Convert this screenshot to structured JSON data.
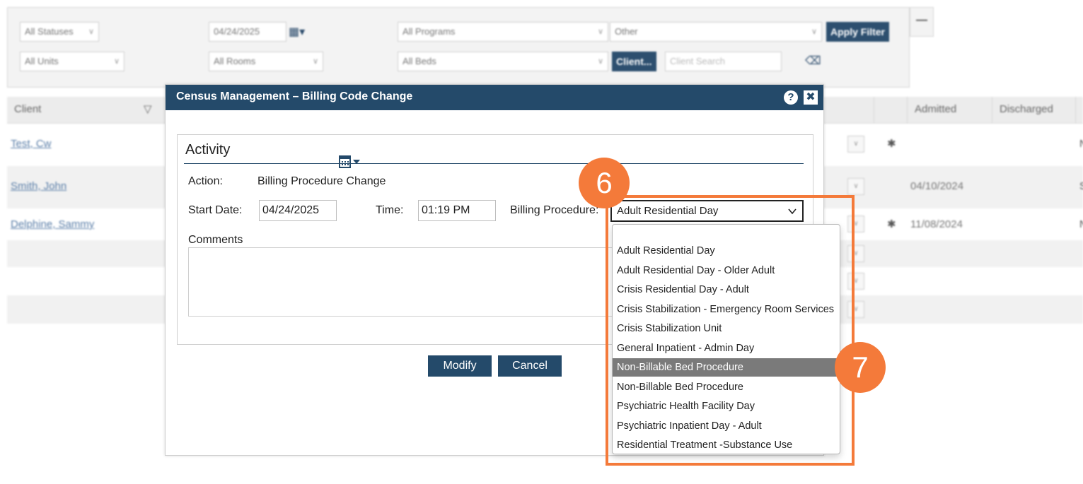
{
  "filters": {
    "row1": {
      "status": "All Statuses",
      "date": "04/24/2025",
      "programs": "All Programs",
      "other": "Other",
      "apply_label": "Apply Filter",
      "collapse_label": "—"
    },
    "row2": {
      "units": "All Units",
      "rooms": "All Rooms",
      "beds": "All Beds",
      "client_button": "Client...",
      "client_search_placeholder": "Client Search"
    }
  },
  "grid": {
    "columns": {
      "client": "Client",
      "filter_icon": "▽",
      "admitted": "Admitted",
      "discharged": "Discharged"
    },
    "rows": [
      {
        "client": "Test, Cw",
        "admitted": "",
        "edge": "N"
      },
      {
        "client": "Smith, John",
        "admitted": "04/10/2024",
        "edge": "S"
      },
      {
        "client": "Delphine, Sammy",
        "admitted": "11/08/2024",
        "edge": "N"
      }
    ]
  },
  "modal": {
    "title": "Census Management – Billing Code Change",
    "help_label": "?",
    "close_label": "✖",
    "section_title": "Activity",
    "action_label": "Action:",
    "action_value": "Billing Procedure Change",
    "start_date_label": "Start Date:",
    "start_date_value": "04/24/2025",
    "time_label": "Time:",
    "time_value": "01:19 PM",
    "billing_label": "Billing Procedure:",
    "billing_value": "Adult Residential Day",
    "comments_label": "Comments",
    "modify_label": "Modify",
    "cancel_label": "Cancel"
  },
  "dropdown": {
    "options": [
      "",
      "Adult Residential Day",
      "Adult Residential Day - Older Adult",
      "Crisis Residential Day - Adult",
      "Crisis Stabilization - Emergency Room Services",
      "Crisis Stabilization Unit",
      "General Inpatient - Admin Day",
      "Non-Billable Bed Procedure",
      "Non-Billable Bed Procedure",
      "Psychiatric Health Facility Day",
      "Psychiatric Inpatient Day - Adult",
      "Residential Treatment -Substance Use"
    ],
    "highlighted_option": "Non-Billable Bed Procedure"
  },
  "callouts": {
    "step6": "6",
    "step7": "7"
  },
  "colors": {
    "header_navy": "#244a6a",
    "callout_orange": "#f47a3a",
    "highlight_grey": "#7a7a7a"
  }
}
